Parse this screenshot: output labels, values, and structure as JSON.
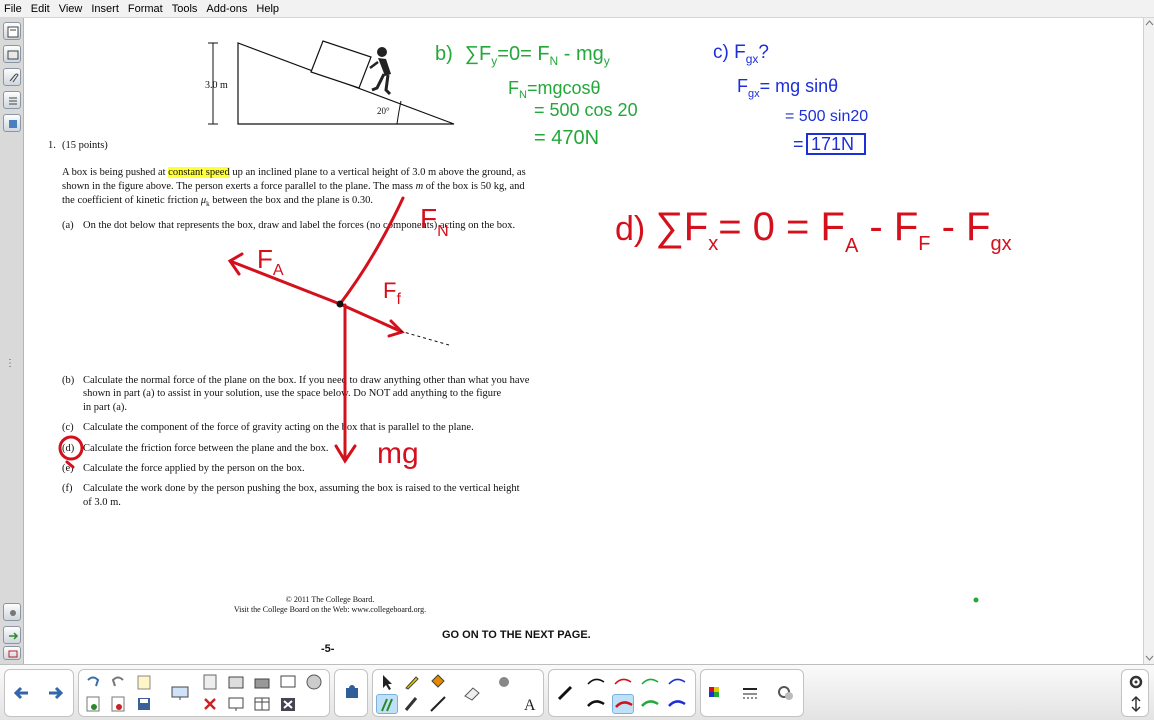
{
  "menu": [
    "File",
    "Edit",
    "View",
    "Insert",
    "Format",
    "Tools",
    "Add-ons",
    "Help"
  ],
  "figure": {
    "height_label": "3.0 m",
    "angle_label": "20°"
  },
  "question": {
    "number": "1.",
    "points": "(15 points)",
    "intro": [
      {
        "pre": "A box is being pushed at ",
        "highlight": "constant speed",
        "post": " up an inclined plane to a vertical height of 3.0 m above the ground, as"
      },
      {
        "pre": "shown in the figure above. The person exerts a force parallel to the plane. The mass ",
        "italic": "m",
        "post": " of the box is 50 kg, and"
      },
      {
        "pre": "the coefficient of kinetic friction  ",
        "italic": "μ",
        "sub": "k",
        "post": "  between the box and the plane is 0.30."
      }
    ],
    "parts": [
      {
        "label": "(a)",
        "lines": [
          "On the dot below that represents the box, draw and label the forces (no components) acting on the box."
        ]
      },
      {
        "label": "(b)",
        "lines": [
          "Calculate the normal force of the plane on the box. If you need to draw anything other than what you have",
          "shown in part (a) to assist in your solution, use the space below. Do NOT add anything to the figure",
          "in part (a)."
        ]
      },
      {
        "label": "(c)",
        "lines": [
          "Calculate the component of the force of gravity acting on the box that is parallel to the plane."
        ]
      },
      {
        "label": "(d)",
        "lines": [
          "Calculate the friction force between the plane and the box."
        ]
      },
      {
        "label": "(e)",
        "lines": [
          "Calculate the force applied by the person on the box."
        ]
      },
      {
        "label": "(f)",
        "lines": [
          "Calculate the work done by the person pushing the box, assuming the box is raised to the vertical height",
          "of 3.0 m."
        ]
      }
    ]
  },
  "handwriting": {
    "fbd": {
      "applied": "F",
      "applied_sub": "A",
      "normal": "F",
      "normal_sub": "N",
      "friction": "F",
      "friction_sub": "f",
      "weight": "mg"
    },
    "part_b": {
      "label": "b)",
      "eq1": "∑F",
      "eq1_sub": "y",
      "eq1_rest": "=0= F",
      "eq1_sub2": "N",
      "eq1_tail": " - mg",
      "eq1_sub3": "y",
      "line2": "F",
      "line2_sub": "N",
      "line2_rest": "=mgcosθ",
      "line3": "= 500 cos 20",
      "line4": "= 470N"
    },
    "part_c": {
      "label": "c) F",
      "label_sub": "gx",
      "label_tail": "?",
      "line2": "F",
      "line2_sub": "gx",
      "line2_rest": "= mg sinθ",
      "line3": "= 500 sin20",
      "line4": "=",
      "boxed": "171N"
    },
    "part_d": {
      "label": "d)",
      "eq": "∑F",
      "eq_sub": "x",
      "eq_rest": "= 0 = F",
      "eq_sub2": "A",
      "eq_mid": " - F",
      "eq_sub3": "F",
      "eq_tail": " - F",
      "eq_sub4": "gx"
    }
  },
  "footer": {
    "copyright": "© 2011 The College Board.",
    "visit": "Visit the College Board on the Web: www.collegeboard.org.",
    "go_on": "GO ON TO THE NEXT PAGE.",
    "page_number": "-5-"
  },
  "colors": {
    "ink_red": "#d4101c",
    "ink_green": "#23a83a",
    "ink_blue": "#1d2fd6",
    "highlight": "#ffff33"
  },
  "toolbar_icons": [
    "back-arrow-icon",
    "forward-arrow-icon",
    "undo-icon",
    "redo-icon",
    "insert-page-icon",
    "clear-page-icon",
    "delete-icon",
    "screen-shade-icon",
    "table-icon",
    "close-icon",
    "screen-capture-icon",
    "document-camera-icon",
    "record-icon",
    "select-icon",
    "pen-icon",
    "creative-pen-icon",
    "fill-icon",
    "eraser-icon",
    "line-icon",
    "text-icon",
    "color-palette-icon",
    "settings-icon",
    "move-toolbar-icon"
  ]
}
